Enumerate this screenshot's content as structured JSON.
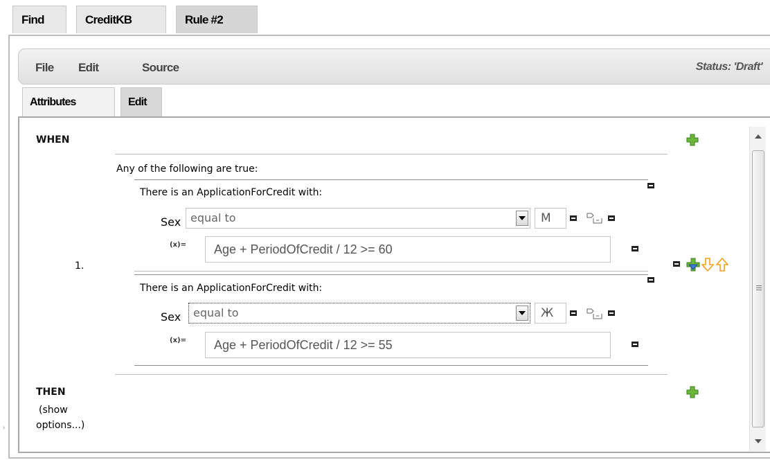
{
  "top_tabs": [
    {
      "label": "Find"
    },
    {
      "label": "CreditKB"
    },
    {
      "label": "Rule #2"
    }
  ],
  "menu": {
    "items": [
      "File",
      "Edit",
      "Source"
    ],
    "status": "Status: 'Draft'"
  },
  "sub_tabs": [
    {
      "label": "Attributes"
    },
    {
      "label": "Edit"
    }
  ],
  "when": {
    "label": "WHEN",
    "row_number": "1.",
    "any_label": "Any of the following are true:",
    "conditions": [
      {
        "fact_label": "There is an ApplicationForCredit with:",
        "field": "Sex",
        "operator": "equal to",
        "value": "M",
        "fx": "(x)=",
        "expression": "Age + PeriodOfCredit / 12 >= 60"
      },
      {
        "fact_label": "There is an ApplicationForCredit with:",
        "field": "Sex",
        "operator": "equal to",
        "value": "Ж",
        "fx": "(x)=",
        "expression": "Age + PeriodOfCredit / 12 >= 55"
      }
    ]
  },
  "then": {
    "label": "THEN",
    "options_line1": "(show",
    "options_line2": "options...)"
  },
  "colors": {
    "plus_green": "#6bb53a",
    "arrow_orange": "#f0a020",
    "arrow_blue": "#3a7bd5"
  },
  "icons": [
    "plus-icon",
    "minus-icon",
    "dropdown-icon",
    "tag-icon",
    "arrow-down-icon",
    "arrow-up-icon",
    "insert-icon",
    "scroll-up-icon",
    "scroll-down-icon"
  ]
}
